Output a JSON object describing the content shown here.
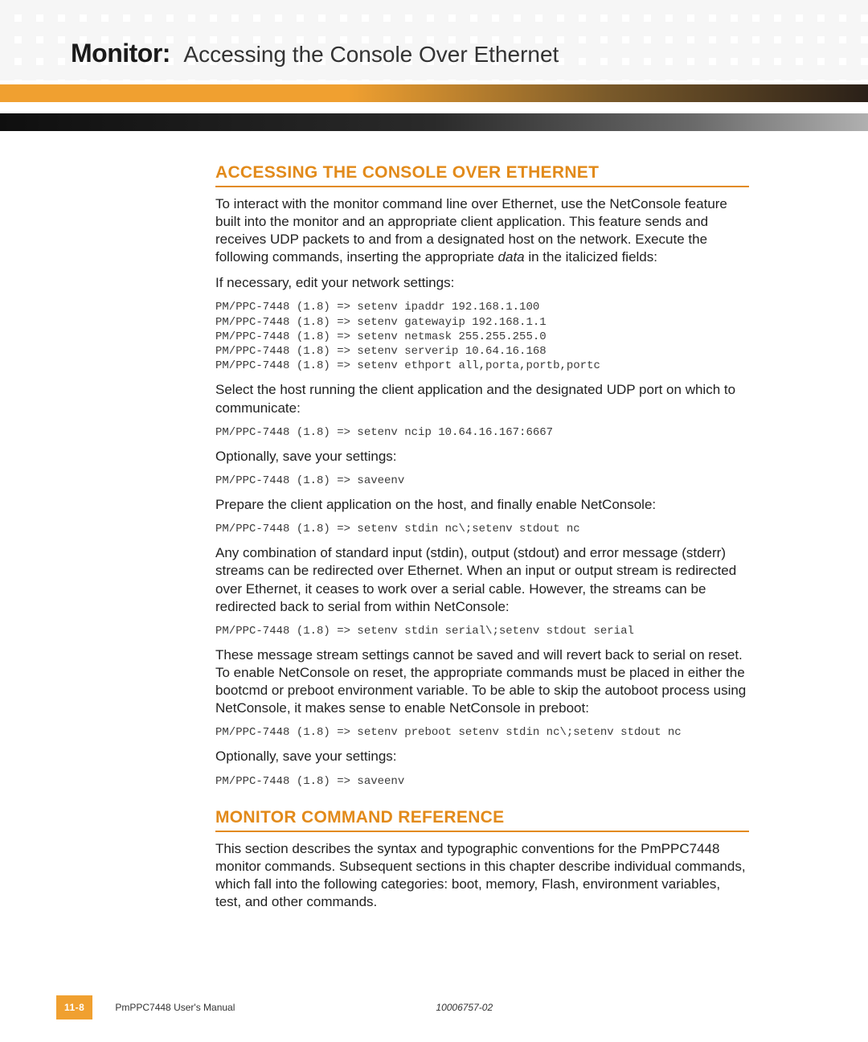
{
  "header": {
    "prefix": "Monitor:",
    "title": "Accessing the Console Over Ethernet"
  },
  "section1": {
    "heading": "ACCESSING THE CONSOLE OVER ETHERNET",
    "p1_a": "To interact with the monitor command line over Ethernet, use the NetConsole feature built into the monitor and an appropriate client application. This feature sends and receives UDP packets to and from a designated host on the network. Execute the following commands, inserting the appropriate ",
    "p1_italic": "data",
    "p1_b": " in the italicized fields:",
    "p2": "If necessary, edit your network settings:",
    "code1": "PM/PPC-7448 (1.8) => setenv ipaddr 192.168.1.100\nPM/PPC-7448 (1.8) => setenv gatewayip 192.168.1.1\nPM/PPC-7448 (1.8) => setenv netmask 255.255.255.0\nPM/PPC-7448 (1.8) => setenv serverip 10.64.16.168\nPM/PPC-7448 (1.8) => setenv ethport all,porta,portb,portc",
    "p3": "Select the host running the client application and the designated UDP port on which to communicate:",
    "code2": "PM/PPC-7448 (1.8) => setenv ncip 10.64.16.167:6667",
    "p4": "Optionally, save your settings:",
    "code3": "PM/PPC-7448 (1.8) => saveenv",
    "p5": "Prepare the client application on the host, and finally enable NetConsole:",
    "code4": "PM/PPC-7448 (1.8) => setenv stdin nc\\;setenv stdout nc",
    "p6": "Any combination of standard input (stdin), output (stdout) and error message (stderr) streams can be redirected over Ethernet. When an input or output stream is redirected over Ethernet, it ceases to work over a serial cable. However, the streams can be redirected back to serial from within NetConsole:",
    "code5": "PM/PPC-7448 (1.8) => setenv stdin serial\\;setenv stdout serial",
    "p7": "These message stream settings cannot be saved and will revert back to serial on reset. To enable NetConsole on reset, the appropriate commands must be placed in either the bootcmd or preboot environment variable. To be able to skip the autoboot process using NetConsole, it makes sense to enable NetConsole in preboot:",
    "code6": "PM/PPC-7448 (1.8) => setenv preboot setenv stdin nc\\;setenv stdout nc",
    "p8": "Optionally, save your settings:",
    "code7": "PM/PPC-7448 (1.8) => saveenv"
  },
  "section2": {
    "heading": "MONITOR COMMAND REFERENCE",
    "p1": "This section describes the syntax and typographic conventions for the PmPPC7448 monitor commands. Subsequent sections in this chapter describe individual commands, which fall into the following categories: boot, memory, Flash, environment variables, test, and other commands."
  },
  "footer": {
    "page": "11-8",
    "manual": "PmPPC7448 User's Manual",
    "docnum": "10006757-02"
  }
}
